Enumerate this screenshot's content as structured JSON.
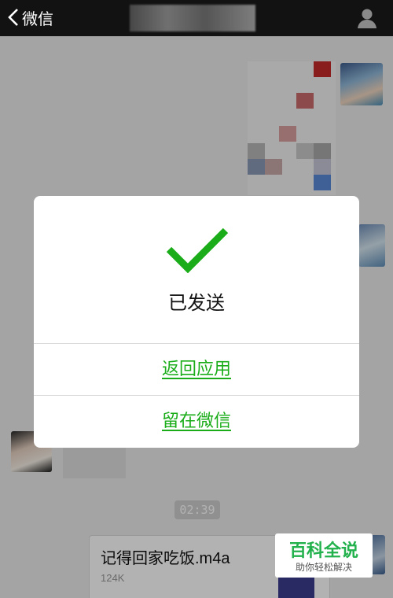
{
  "navbar": {
    "back_label": "微信",
    "back_icon": "chevron-left-icon",
    "profile_icon": "person-icon"
  },
  "chat": {
    "time_stamp": "02:39",
    "file_message": {
      "name": "记得回家吃饭.m4a",
      "size": "124K",
      "icon": "music-file-icon"
    }
  },
  "dialog": {
    "status_icon": "checkmark-icon",
    "status_text": "已发送",
    "return_button": "返回应用",
    "stay_button": "留在微信",
    "accent_color": "#1aad19"
  },
  "watermark": {
    "title": "百科全说",
    "subtitle": "助你轻松解决"
  }
}
